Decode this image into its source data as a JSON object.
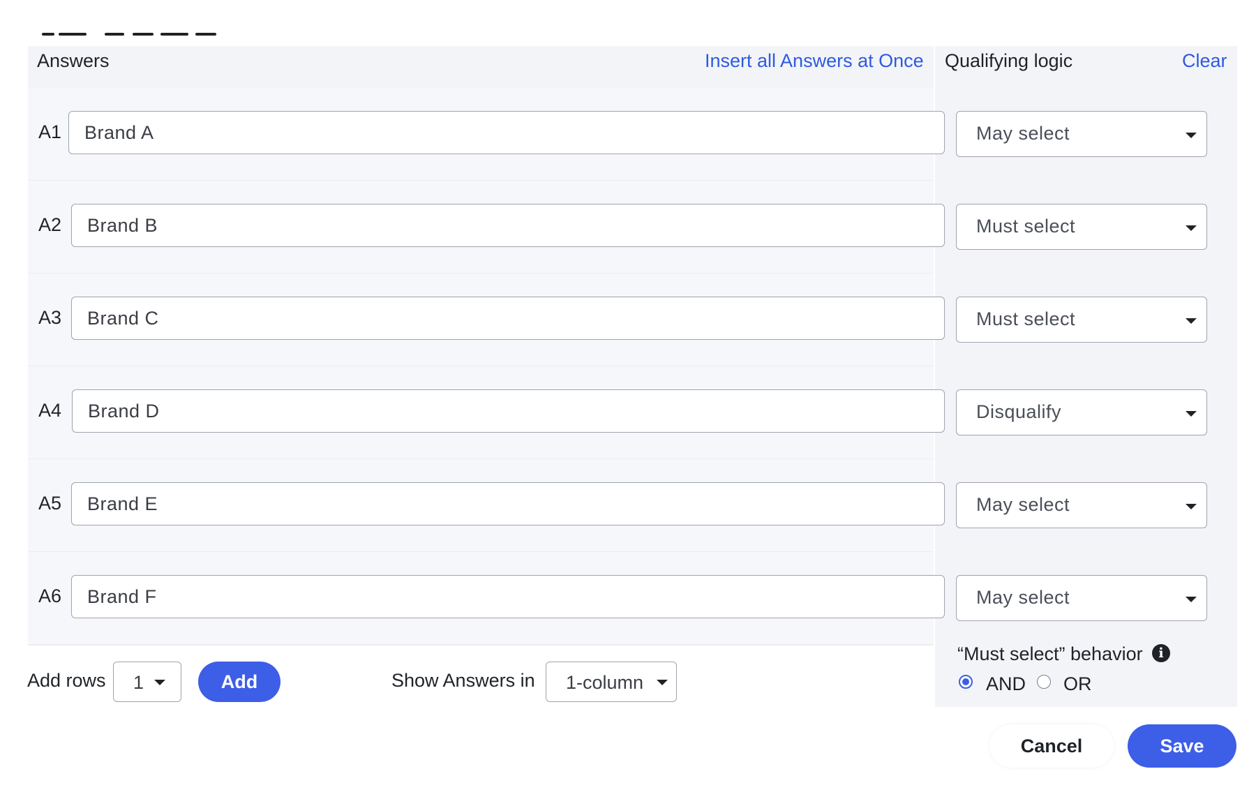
{
  "header": {
    "answers_title": "Answers",
    "insert_all_link": "Insert all Answers at Once",
    "qualifying_title": "Qualifying logic",
    "clear_link": "Clear"
  },
  "answers": [
    {
      "label": "A1",
      "value": "Brand A",
      "logic": "May select"
    },
    {
      "label": "A2",
      "value": "Brand B",
      "logic": "Must select"
    },
    {
      "label": "A3",
      "value": "Brand C",
      "logic": "Must select"
    },
    {
      "label": "A4",
      "value": "Brand D",
      "logic": "Disqualify"
    },
    {
      "label": "A5",
      "value": "Brand E",
      "logic": "May select"
    },
    {
      "label": "A6",
      "value": "Brand F",
      "logic": "May select"
    }
  ],
  "footer": {
    "add_rows_label": "Add rows",
    "add_rows_value": "1",
    "add_button": "Add",
    "show_answers_label": "Show Answers in",
    "show_answers_value": "1-column"
  },
  "must_select": {
    "title": "“Must select” behavior",
    "info_icon": "info-icon",
    "and_label": "AND",
    "or_label": "OR",
    "selected": "AND"
  },
  "actions": {
    "cancel": "Cancel",
    "save": "Save"
  },
  "colors": {
    "accent": "#3d5ee6",
    "link": "#2f5ae0",
    "panel_bg": "#f3f4f8"
  }
}
